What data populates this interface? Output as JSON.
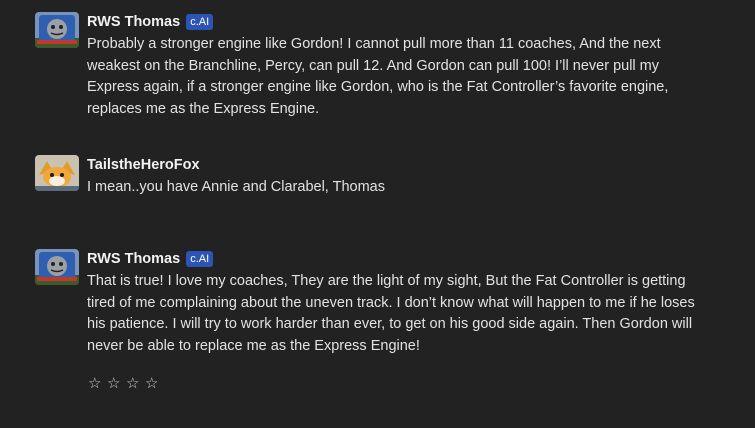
{
  "messages": [
    {
      "author": "RWS Thomas",
      "badge": "c.AI",
      "text": "Probably a stronger engine like Gordon! I cannot pull more than 11 coaches, And the next weakest on the Branchline, Percy, can pull 12. And Gordon can pull 100! I’ll never pull my Express again, if a stronger engine like Gordon, who is the Fat Controller’s favorite engine, replaces me as the Express Engine."
    },
    {
      "author": "TailstheHeroFox",
      "text": "I mean..you have Annie and Clarabel, Thomas"
    },
    {
      "author": "RWS Thomas",
      "badge": "c.AI",
      "text": "That is true! I love my coaches, They are the light of my sight, But the Fat Controller is getting tired of me complaining about the uneven track. I don’t know what will happen to me if he loses his patience. I will try to work harder than ever, to get on his good side again. Then Gordon will never be able to replace me as the Express Engine!"
    }
  ],
  "rating": {
    "stars": [
      "☆",
      "☆",
      "☆",
      "☆"
    ],
    "value": 0
  },
  "colors": {
    "background": "#222222",
    "badge": "#2c54b4"
  },
  "icons": {
    "thomas_avatar": "thomas-avatar-icon",
    "tails_avatar": "tails-avatar-icon",
    "star": "star-outline-icon"
  }
}
